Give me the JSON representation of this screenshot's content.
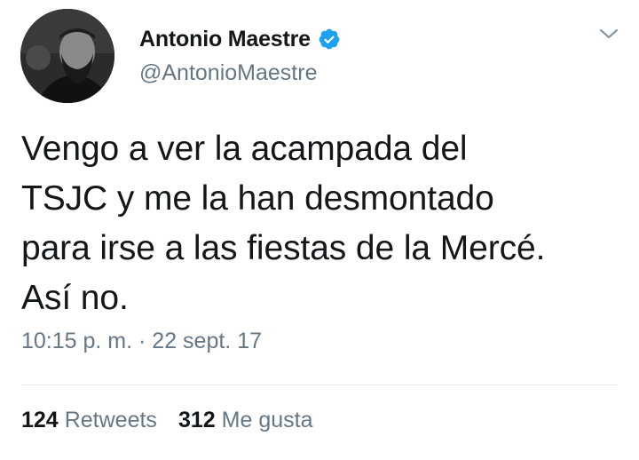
{
  "author": {
    "display_name": "Antonio Maestre",
    "handle": "@AntonioMaestre",
    "verified": true
  },
  "tweet": {
    "text": "Vengo a ver la acampada del\nTSJC y me la han desmontado\npara irse a las fiestas de la Mercé.\nAsí no.",
    "timestamp": "10:15 p. m. · 22 sept. 17"
  },
  "stats": {
    "retweets_count": "124",
    "retweets_label": "Retweets",
    "likes_count": "312",
    "likes_label": "Me gusta"
  },
  "colors": {
    "text": "#14171a",
    "secondary": "#657786",
    "verified_blue": "#1da1f2",
    "divider": "#e1e8ed"
  },
  "icons": {
    "verified": "verified-badge-icon",
    "menu": "chevron-down-icon"
  }
}
